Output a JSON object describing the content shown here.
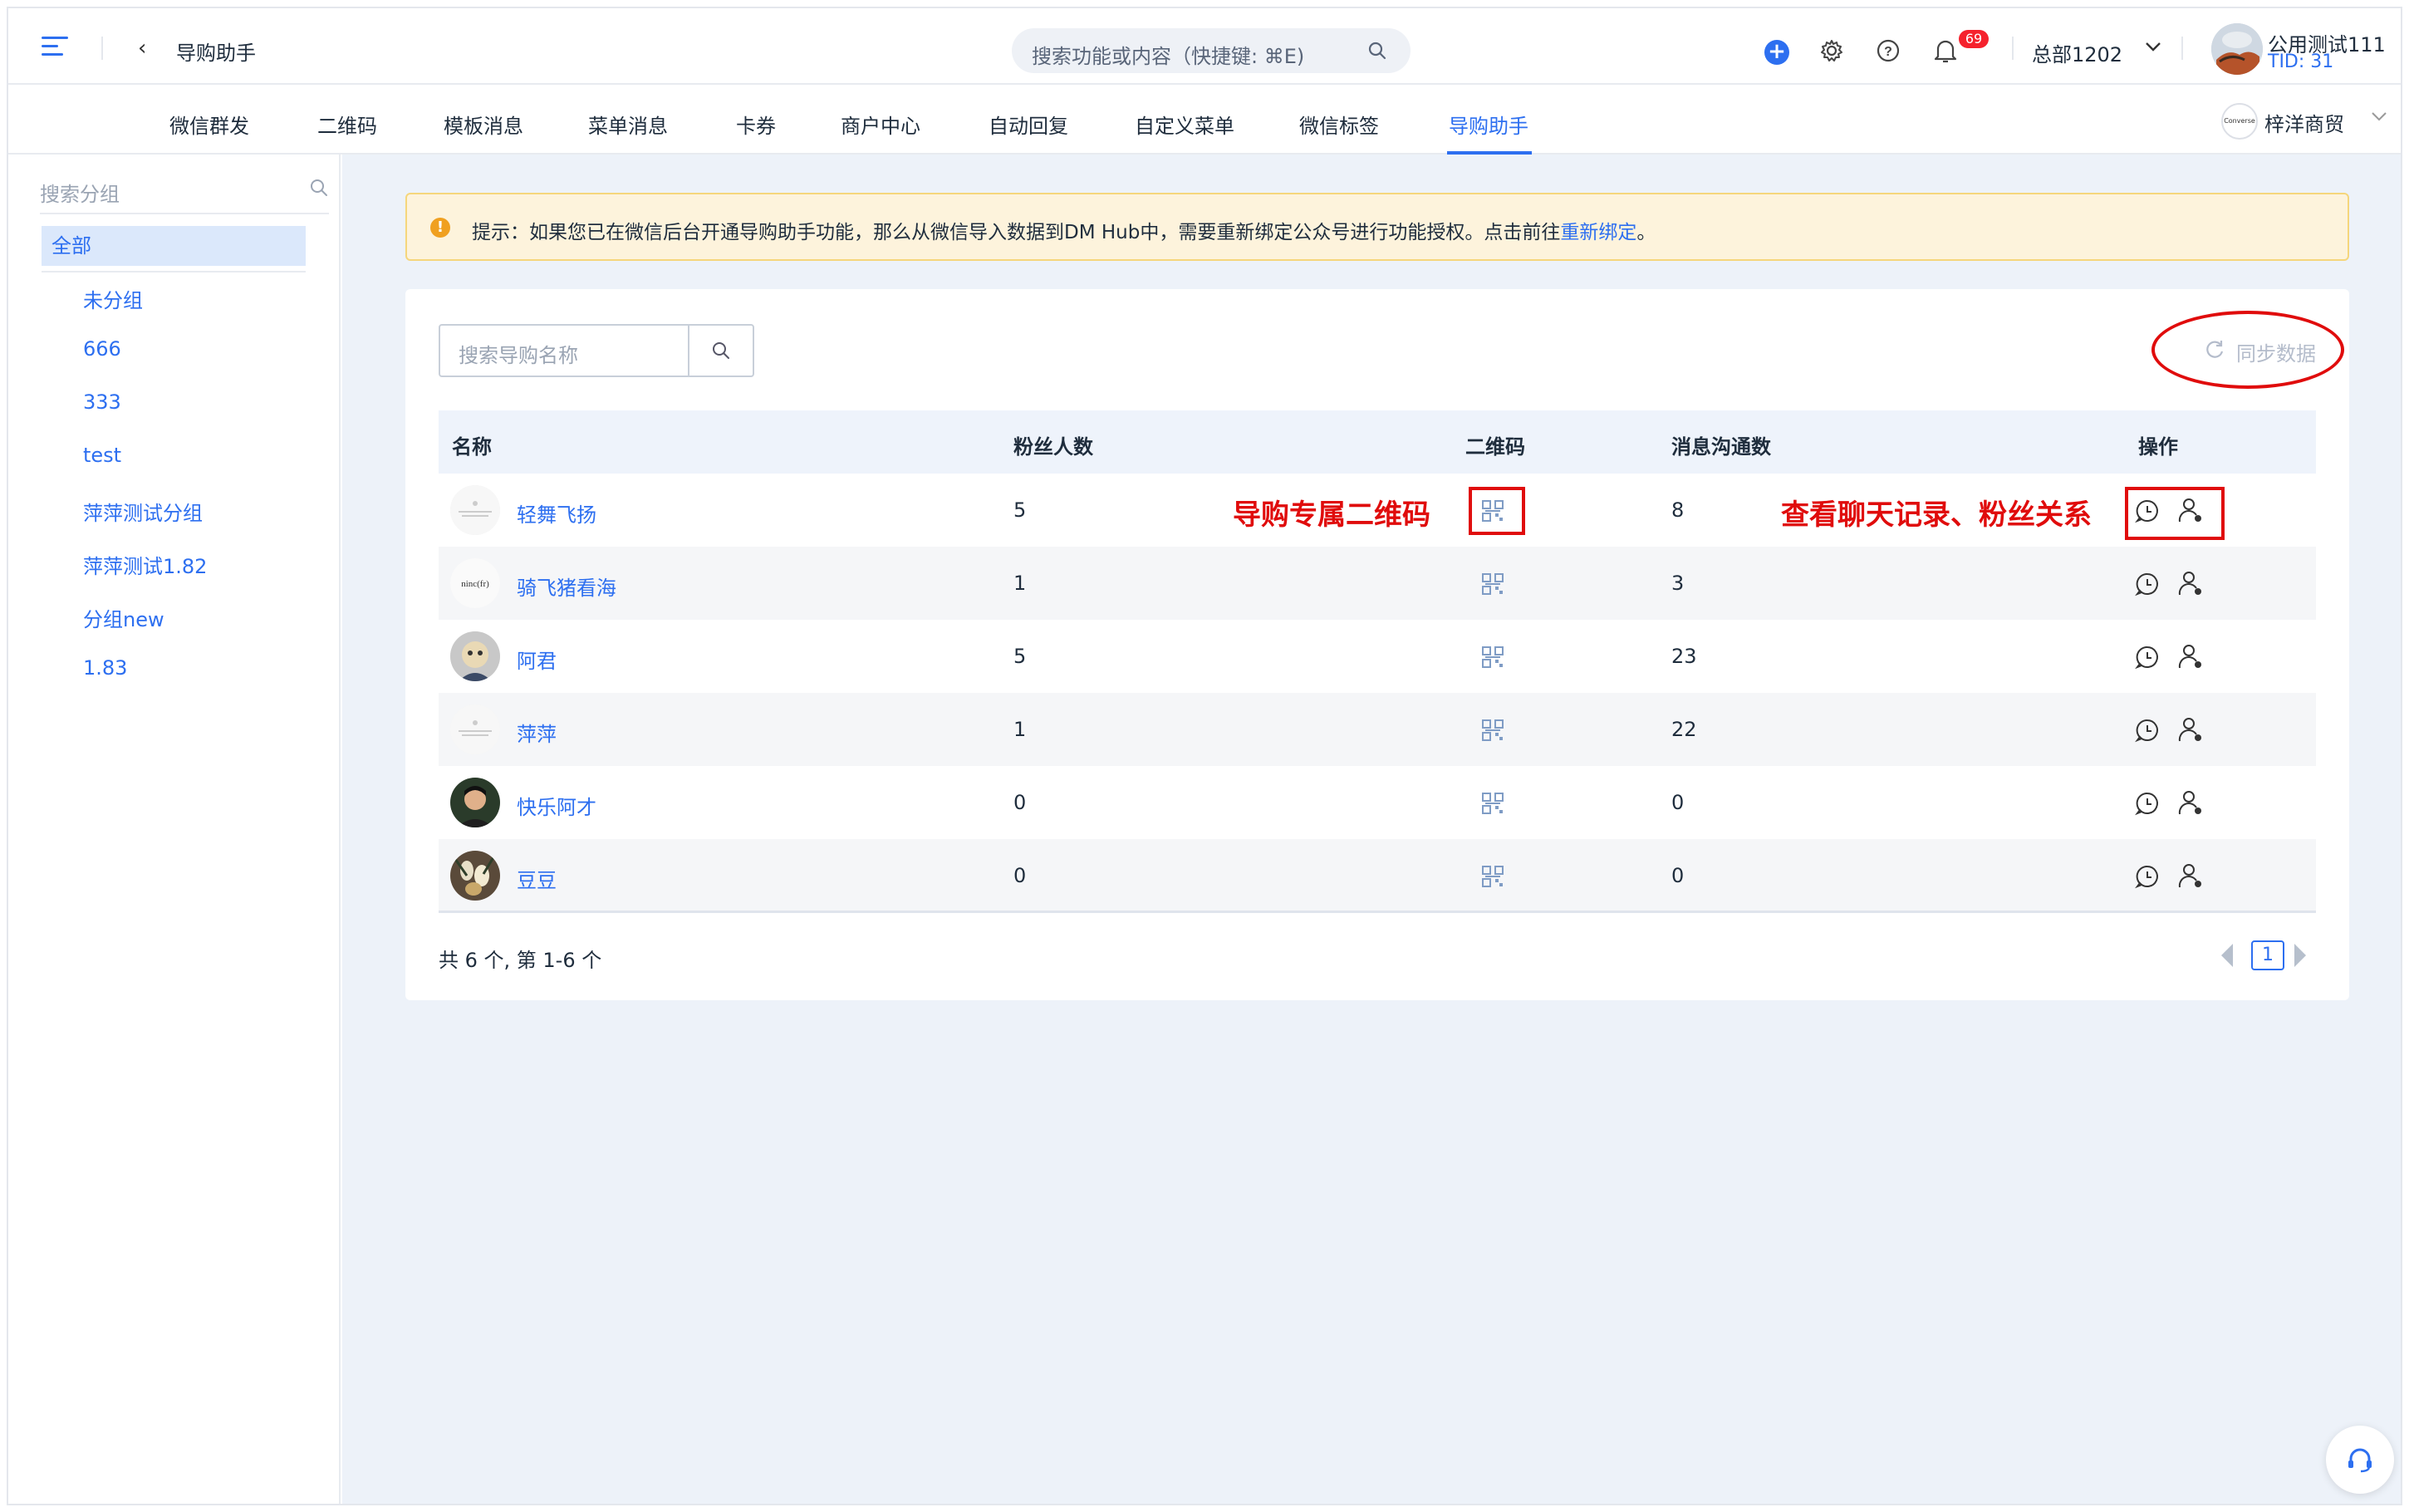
{
  "header": {
    "title": "导购助手",
    "search_placeholder": "搜索功能或内容（快捷键: ⌘E)",
    "notification_count": "69",
    "org_name": "总部1202",
    "user_name": "公用测试111",
    "user_tid": "TID: 31",
    "accent": "#2d6ff0"
  },
  "tabs": [
    {
      "label": "微信群发"
    },
    {
      "label": "二维码"
    },
    {
      "label": "模板消息"
    },
    {
      "label": "菜单消息"
    },
    {
      "label": "卡券"
    },
    {
      "label": "商户中心"
    },
    {
      "label": "自动回复"
    },
    {
      "label": "自定义菜单"
    },
    {
      "label": "微信标签"
    },
    {
      "label": "导购助手"
    }
  ],
  "active_tab": "导购助手",
  "merchant": {
    "name": "梓洋商贸",
    "logo_text": "Converse"
  },
  "sidebar": {
    "search_placeholder": "搜索分组",
    "all_label": "全部",
    "groups": [
      "未分组",
      "666",
      "333",
      "test",
      "萍萍测试分组",
      "萍萍测试1.82",
      "分组new",
      "1.83"
    ]
  },
  "notice": {
    "text": "提示：如果您已在微信后台开通导购助手功能，那么从微信导入数据到DM Hub中，需要重新绑定公众号进行功能授权。点击前往",
    "link": "重新绑定",
    "end": "。"
  },
  "toolbar": {
    "search_placeholder": "搜索导购名称",
    "sync_label": "同步数据"
  },
  "table": {
    "columns": [
      "名称",
      "粉丝人数",
      "二维码",
      "消息沟通数",
      "操作"
    ],
    "rows": [
      {
        "name": "轻舞飞扬",
        "fans": "5",
        "messages": "8",
        "avatar": "placeholder-avatar"
      },
      {
        "name": "骑飞猪看海",
        "fans": "1",
        "messages": "3",
        "avatar": "text-avatar"
      },
      {
        "name": "阿君",
        "fans": "5",
        "messages": "23",
        "avatar": "photo-avatar"
      },
      {
        "name": "萍萍",
        "fans": "1",
        "messages": "22",
        "avatar": "placeholder-avatar"
      },
      {
        "name": "快乐阿才",
        "fans": "0",
        "messages": "0",
        "avatar": "photo-avatar"
      },
      {
        "name": "豆豆",
        "fans": "0",
        "messages": "0",
        "avatar": "photo-avatar"
      }
    ]
  },
  "annotations": {
    "qr_label": "导购专属二维码",
    "actions_label": "查看聊天记录、粉丝关系",
    "color": "#e00c0c"
  },
  "pagination": {
    "summary": "共 6 个, 第 1-6 个",
    "current_page": "1"
  }
}
